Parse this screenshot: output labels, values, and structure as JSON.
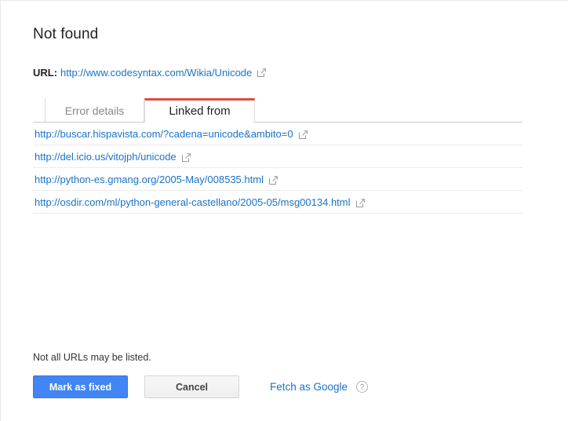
{
  "page": {
    "title": "Not found"
  },
  "url_info": {
    "label": "URL:",
    "value": "http://www.codesyntax.com/Wikia/Unicode",
    "external_icon": "external-link-icon"
  },
  "tabs": [
    {
      "label": "Error details",
      "active": false
    },
    {
      "label": "Linked from",
      "active": true
    }
  ],
  "linked_from": {
    "rows": [
      {
        "url": "http://buscar.hispavista.com/?cadena=unicode&ambito=0"
      },
      {
        "url": "http://del.icio.us/vitojph/unicode"
      },
      {
        "url": "http://python-es.gmang.org/2005-May/008535.html"
      },
      {
        "url": "http://osdir.com/ml/python-general-castellano/2005-05/msg00134.html"
      }
    ]
  },
  "footer": {
    "note": "Not all URLs may be listed.",
    "primary_button": "Mark as fixed",
    "secondary_button": "Cancel",
    "fetch_link": "Fetch as Google",
    "help_glyph": "?"
  },
  "colors": {
    "accent_red": "#dd4b39",
    "link_blue": "#1a73c8",
    "primary_button_blue": "#4285f4",
    "border_gray": "#cccccc",
    "row_divider": "#ececec"
  }
}
